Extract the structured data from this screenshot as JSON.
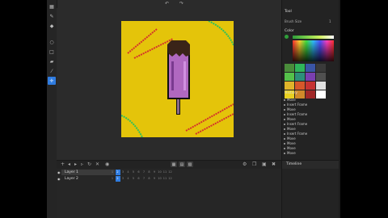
{
  "toolbar": {
    "tools": [
      {
        "icon": "grid-icon",
        "glyph": "▦",
        "active": false
      },
      {
        "icon": "pencil-icon",
        "glyph": "✎",
        "active": false
      },
      {
        "icon": "fill-icon",
        "glyph": "◆",
        "active": false
      },
      {
        "icon": "circle-icon",
        "glyph": "○",
        "active": false
      },
      {
        "icon": "rect-icon",
        "glyph": "□",
        "active": false
      },
      {
        "icon": "eraser-icon",
        "glyph": "▰",
        "active": false
      },
      {
        "icon": "eyedropper-icon",
        "glyph": "⁄",
        "active": false
      },
      {
        "icon": "move-icon",
        "glyph": "✛",
        "active": true
      }
    ]
  },
  "topbar": {
    "undo": "↶",
    "redo": "↷"
  },
  "tool_panel": {
    "title": "Tool",
    "brush_label": "Brush Size",
    "brush_value": "1"
  },
  "color_panel": {
    "title": "Color",
    "primary": "#2f9e3a",
    "swatches": [
      [
        "#4a8d3b",
        "#2fb55a",
        "#3a55a5",
        "#3a3a3a"
      ],
      [
        "#55c24a",
        "#2d8f7a",
        "#7a3fb0",
        "#505050"
      ],
      [
        "#e0b42a",
        "#d6582a",
        "#c63232",
        "#e0e0e0"
      ],
      [
        "#e8d020",
        "#d08a2a",
        "#a02828",
        "#ffffff"
      ]
    ]
  },
  "history": {
    "title": "History",
    "items": [
      "Move",
      "Insert Frame",
      "Move",
      "Insert Frame",
      "Move",
      "Insert Frame",
      "Move",
      "Insert Frame",
      "Move",
      "Move",
      "Move",
      "Move"
    ]
  },
  "timeline_panel": {
    "title": "Timeline"
  },
  "layers": [
    {
      "name": "Layer 1",
      "selected": true
    },
    {
      "name": "Layer 2",
      "selected": false
    }
  ],
  "frames": [
    "1",
    "2",
    "3",
    "4",
    "5",
    "6",
    "7",
    "8",
    "9",
    "10",
    "11",
    "12"
  ],
  "current_frame": 2,
  "colors": {
    "yellow": "#e4c40a",
    "red": "#d4322a",
    "green": "#2ec05a",
    "purple": "#b068c0",
    "darkpurple": "#7a3a90",
    "choc": "#3a2418",
    "outline": "#101010"
  }
}
